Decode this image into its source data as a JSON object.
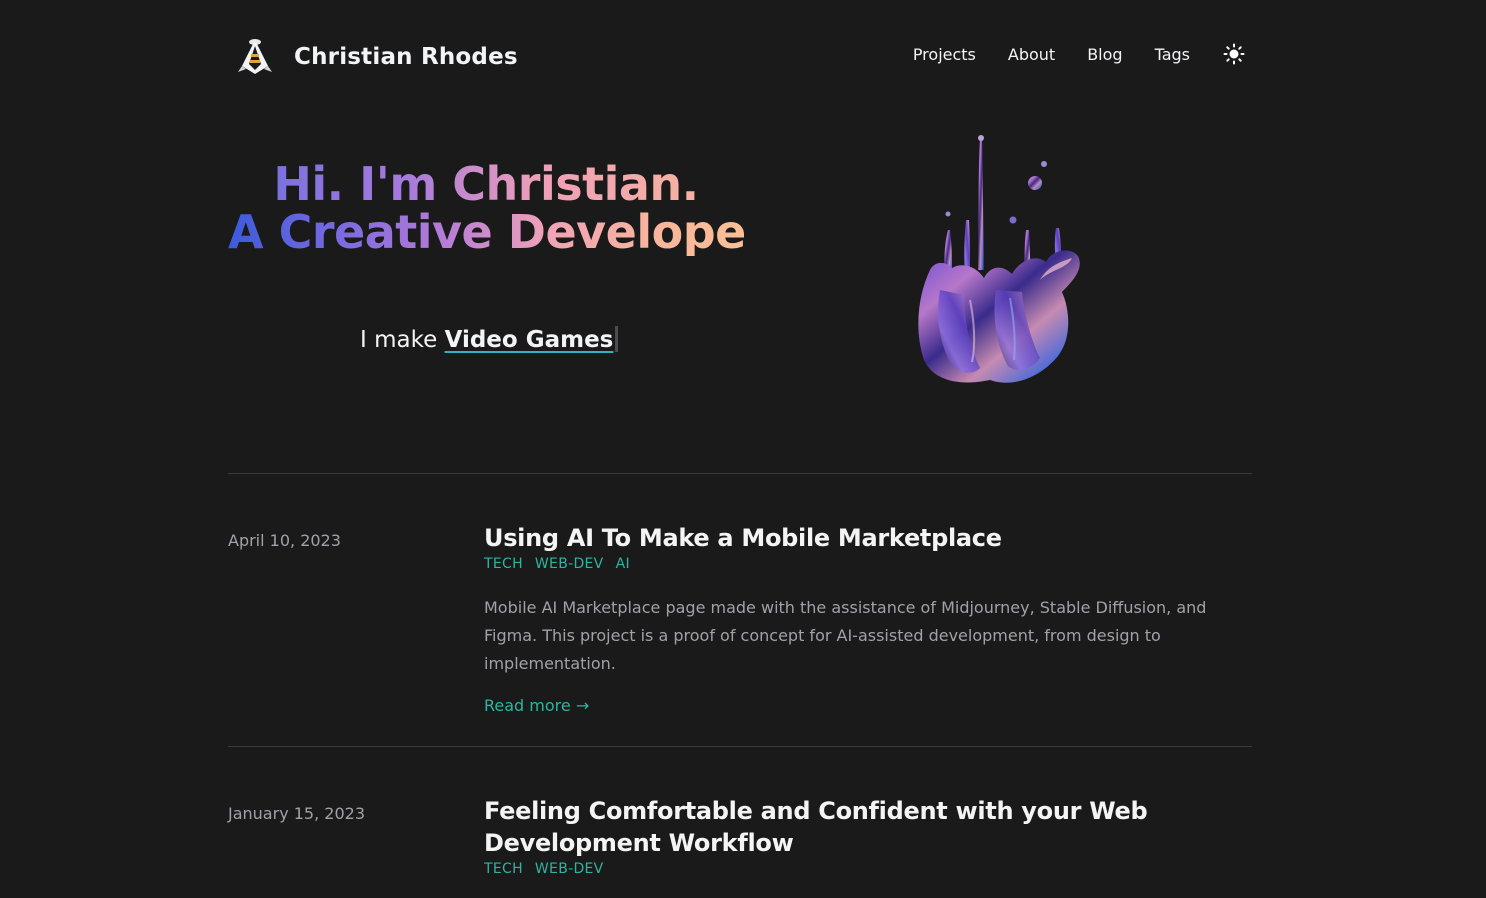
{
  "header": {
    "site_title": "Christian Rhodes",
    "logo_icon": "bee-logo-icon",
    "nav": [
      {
        "label": "Projects"
      },
      {
        "label": "About"
      },
      {
        "label": "Blog"
      },
      {
        "label": "Tags"
      }
    ],
    "theme_toggle_icon": "sun-icon"
  },
  "hero": {
    "line1": "Hi. I'm Christian.",
    "line2": "A Creative Developer",
    "tagline_prefix": "I make",
    "tagline_highlight": "Video Games",
    "image_icon": "abstract-iridescent-blob-image"
  },
  "posts": [
    {
      "date": "April 10, 2023",
      "title": "Using AI To Make a Mobile Marketplace",
      "tags": [
        "TECH",
        "WEB-DEV",
        "AI"
      ],
      "summary": "Mobile AI Marketplace page made with the assistance of Midjourney, Stable Diffusion, and Figma. This project is a proof of concept for AI-assisted development, from design to implementation.",
      "read_more": "Read more →"
    },
    {
      "date": "January 15, 2023",
      "title": "Feeling Comfortable and Confident with your Web Development Workflow",
      "tags": [
        "TECH",
        "WEB-DEV"
      ]
    }
  ],
  "colors": {
    "background": "#1a1a1b",
    "accent_teal": "#2cb5a0",
    "text_muted": "#a1a1aa",
    "underline": "#2db4c8"
  }
}
